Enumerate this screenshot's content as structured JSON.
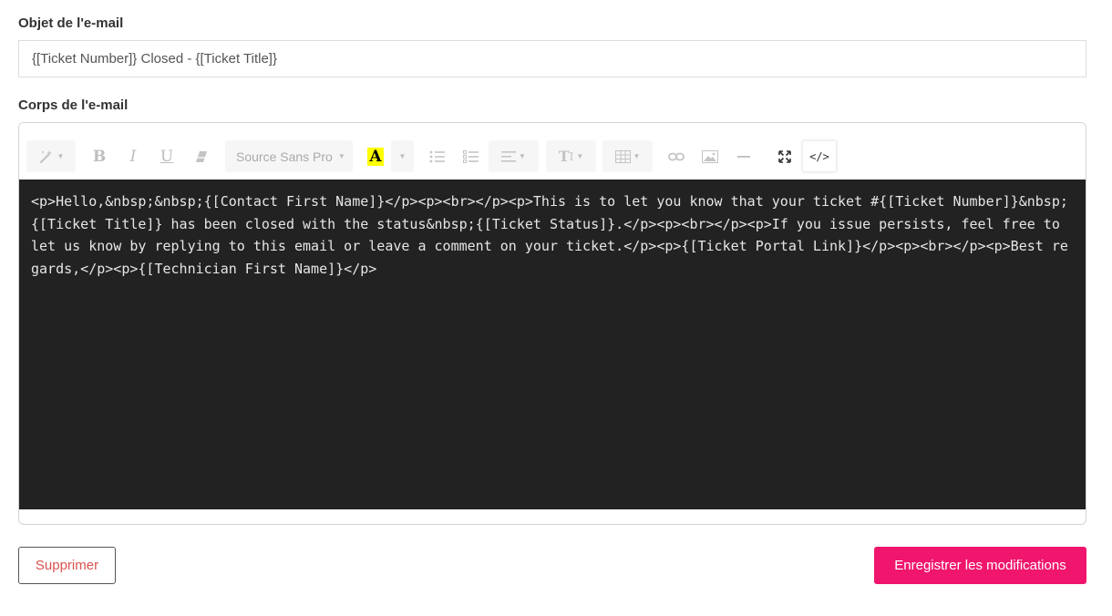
{
  "form": {
    "subject_label": "Objet de l'e-mail",
    "subject_value": "{[Ticket Number]} Closed - {[Ticket Title]}",
    "body_label": "Corps de l'e-mail",
    "body_html": "<p>Hello,&nbsp;&nbsp;{[Contact First Name]}</p><p><br></p><p>This is to let you know that your ticket #{[Ticket Number]}&nbsp; {[Ticket Title]} has been closed with the status&nbsp;{[Ticket Status]}.</p><p><br></p><p>If you issue persists, feel free to let us know by replying to this email or leave a comment on your ticket.</p><p>{[Ticket Portal Link]}</p><p><br></p><p>Best regards,</p><p>{[Technician First Name]}</p>"
  },
  "toolbar": {
    "font_name": "Source Sans Pro",
    "code_view_label": "</>",
    "highlight_color": "#ffff00",
    "icons": [
      "magic-wand-icon",
      "bold-icon",
      "italic-icon",
      "underline-icon",
      "eraser-icon",
      "font-family-dropdown",
      "text-color-icon",
      "unordered-list-icon",
      "ordered-list-icon",
      "align-icon",
      "font-size-icon",
      "table-icon",
      "link-icon",
      "picture-icon",
      "horizontal-rule-icon",
      "fullscreen-icon",
      "code-view-icon"
    ]
  },
  "actions": {
    "delete_label": "Supprimer",
    "save_label": "Enregistrer les modifications",
    "save_color": "#f0166d",
    "delete_color": "#d9534f"
  }
}
